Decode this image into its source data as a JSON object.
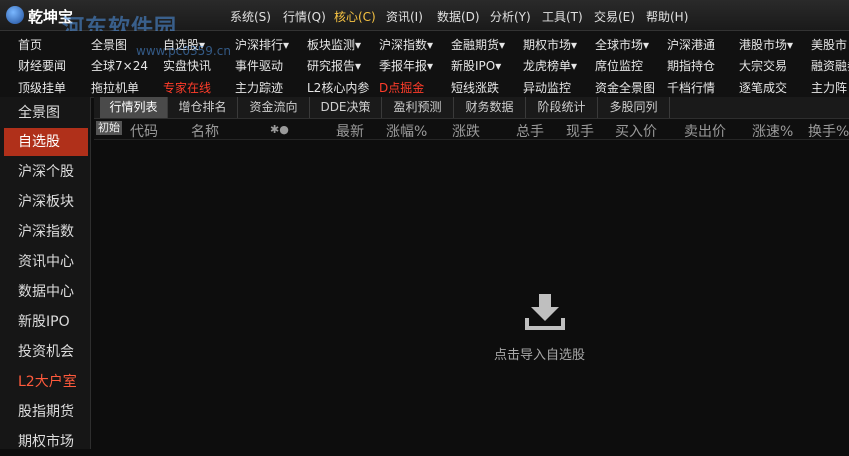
{
  "app": {
    "title": "乾坤宝",
    "watermark": "河东软件园",
    "watermark_url": "www.pc0359.cn"
  },
  "menu": [
    "系统(S)",
    "行情(Q)",
    "核心(C)",
    "资讯(I)",
    "数据(D)",
    "分析(Y)",
    "工具(T)",
    "交易(E)",
    "帮助(H)"
  ],
  "active_menu_index": 2,
  "nav": {
    "row1": [
      "首页",
      "全景图",
      "自选股▾",
      "沪深排行▾",
      "板块监测▾",
      "沪深指数▾",
      "金融期货▾",
      "期权市场▾",
      "全球市场▾",
      "沪深港通",
      "港股市场▾",
      "美股市"
    ],
    "row2": [
      "财经要闻",
      "全球7×24",
      "实盘快讯",
      "事件驱动",
      "研究报告▾",
      "季报年报▾",
      "新股IPO▾",
      "龙虎榜单▾",
      "席位监控",
      "期指持仓",
      "大宗交易",
      "融资融券"
    ],
    "row3": [
      "顶级挂单",
      "拖拉机单",
      "专家在线",
      "主力踪迹",
      "L2核心内参",
      "D点掘金",
      "短线涨跌",
      "异动监控",
      "资金全景图",
      "千档行情",
      "逐笔成交",
      "主力阵"
    ]
  },
  "sidebar": [
    {
      "label": "全景图"
    },
    {
      "label": "自选股"
    },
    {
      "label": "沪深个股"
    },
    {
      "label": "沪深板块"
    },
    {
      "label": "沪深指数"
    },
    {
      "label": "资讯中心"
    },
    {
      "label": "数据中心"
    },
    {
      "label": "新股IPO"
    },
    {
      "label": "投资机会"
    },
    {
      "label": "L2大户室"
    },
    {
      "label": "股指期货"
    },
    {
      "label": "期权市场"
    }
  ],
  "tabs": [
    "行情列表",
    "增仓排名",
    "资金流向",
    "DDE决策",
    "盈利预测",
    "财务数据",
    "阶段统计",
    "多股同列"
  ],
  "columns": {
    "init_badge": "初始",
    "headers": [
      "代码",
      "名称",
      "✱●",
      "最新",
      "涨幅%",
      "涨跌",
      "总手",
      "现手",
      "买入价",
      "卖出价",
      "涨速%",
      "换手%"
    ]
  },
  "empty_state": {
    "text": "点击导入自选股"
  },
  "colors": {
    "accent_red": "#b0301a",
    "menu_active": "#f5c242",
    "highlight_text": "#ff3c2a"
  }
}
